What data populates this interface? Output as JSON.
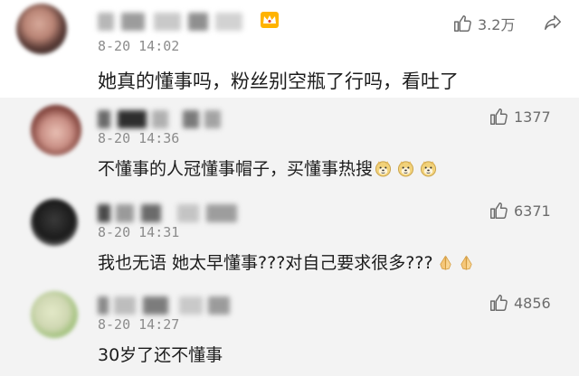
{
  "comments": [
    {
      "timestamp": "8-20 14:02",
      "text": "她真的懂事吗，粉丝别空瓶了行吗，看吐了",
      "likes": "3.2万",
      "has_crown": true,
      "has_share": true
    },
    {
      "timestamp": "8-20 14:36",
      "text": "不懂事的人冠懂事帽子，买懂事热搜",
      "likes": "1377",
      "emojis": [
        "doge-emoji",
        "doge-emoji",
        "doge-emoji"
      ]
    },
    {
      "timestamp": "8-20 14:31",
      "text": "我也无语 她太早懂事???对自己要求很多???",
      "likes": "6371",
      "emojis": [
        "pray-emoji",
        "pray-emoji"
      ]
    },
    {
      "timestamp": "8-20 14:27",
      "text": "30岁了还不懂事",
      "likes": "4856"
    }
  ],
  "colors": {
    "highlight_bg": "#f3f3f3",
    "timestamp": "#8c8c8c",
    "like_text": "#6c6c6c",
    "crown": "#f0a020"
  }
}
